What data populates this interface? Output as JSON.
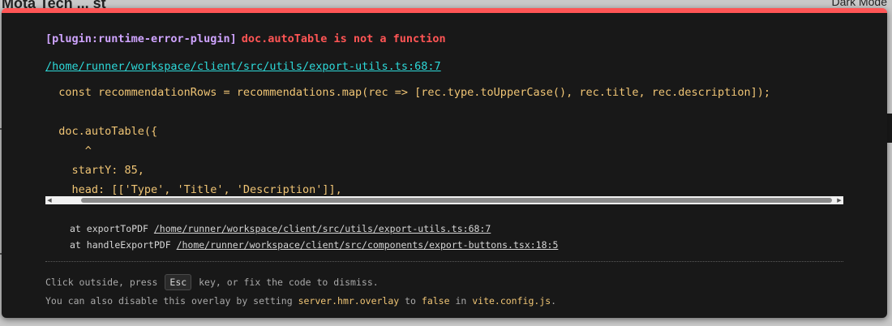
{
  "background": {
    "title": "Mota Tech ... st",
    "right_text": "Dark Mode"
  },
  "overlay": {
    "plugin": "[plugin:runtime-error-plugin]",
    "message": "doc.autoTable is not a function",
    "file": "/home/runner/workspace/client/src/utils/export-utils.ts:68:7",
    "code_lines": [
      "  const recommendationRows = recommendations.map(rec => [rec.type.toUpperCase(), rec.title, rec.description]);",
      "",
      "  doc.autoTable({",
      "      ^",
      "    startY: 85,",
      "    head: [['Type', 'Title', 'Description']],"
    ],
    "stack": [
      {
        "prefix": "at exportToPDF ",
        "location": "/home/runner/workspace/client/src/utils/export-utils.ts:68:7"
      },
      {
        "prefix": "at handleExportPDF ",
        "location": "/home/runner/workspace/client/src/components/export-buttons.tsx:18:5"
      }
    ],
    "tip1": {
      "before": "Click outside, press ",
      "key": "Esc",
      "after": " key, or fix the code to dismiss."
    },
    "tip2": {
      "before": "You can also disable this overlay by setting ",
      "setting": "server.hmr.overlay",
      "mid": " to ",
      "value": "false",
      "in": " in ",
      "file": "vite.config.js",
      "end": "."
    }
  },
  "colors": {
    "accent_red": "#ff5555",
    "plugin_purple": "#cfa4ff",
    "link_cyan": "#2dd9d9",
    "code_yellow": "#f0c575"
  }
}
